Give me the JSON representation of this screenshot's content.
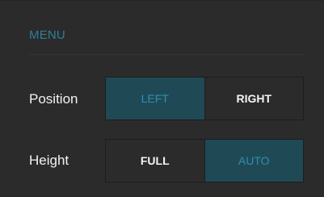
{
  "menu": {
    "title": "MENU"
  },
  "settings": {
    "position": {
      "label": "Position",
      "options": [
        "LEFT",
        "RIGHT"
      ],
      "selected": "LEFT"
    },
    "height": {
      "label": "Height",
      "options": [
        "FULL",
        "AUTO"
      ],
      "selected": "AUTO"
    }
  },
  "colors": {
    "background": "#2b2b2b",
    "accent": "#2f7f98",
    "active_fill": "#1f4a55",
    "border": "#1d1d1d",
    "text": "#f2f2f2"
  }
}
